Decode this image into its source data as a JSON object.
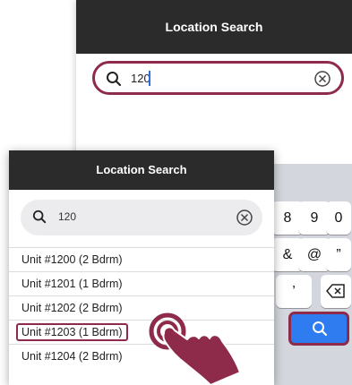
{
  "back_screen": {
    "title": "Location Search",
    "search": {
      "value": "120"
    },
    "keys": [
      "8",
      "9",
      "0",
      "&",
      "@",
      "”",
      "’"
    ]
  },
  "front_card": {
    "title": "Location Search",
    "search": {
      "value": "120"
    },
    "results": [
      "Unit #1200 (2 Bdrm)",
      "Unit #1201 (1 Bdrm)",
      "Unit #1202 (2 Bdrm)",
      "Unit #1203 (1 Bdrm)",
      "Unit #1204 (2 Bdrm)"
    ],
    "highlighted_result": "Unit #1203 (1 Bdrm)"
  },
  "colors": {
    "header": "#2b2b2b",
    "highlight": "#8e2a4a",
    "keyboard_search": "#2f7bf0"
  }
}
